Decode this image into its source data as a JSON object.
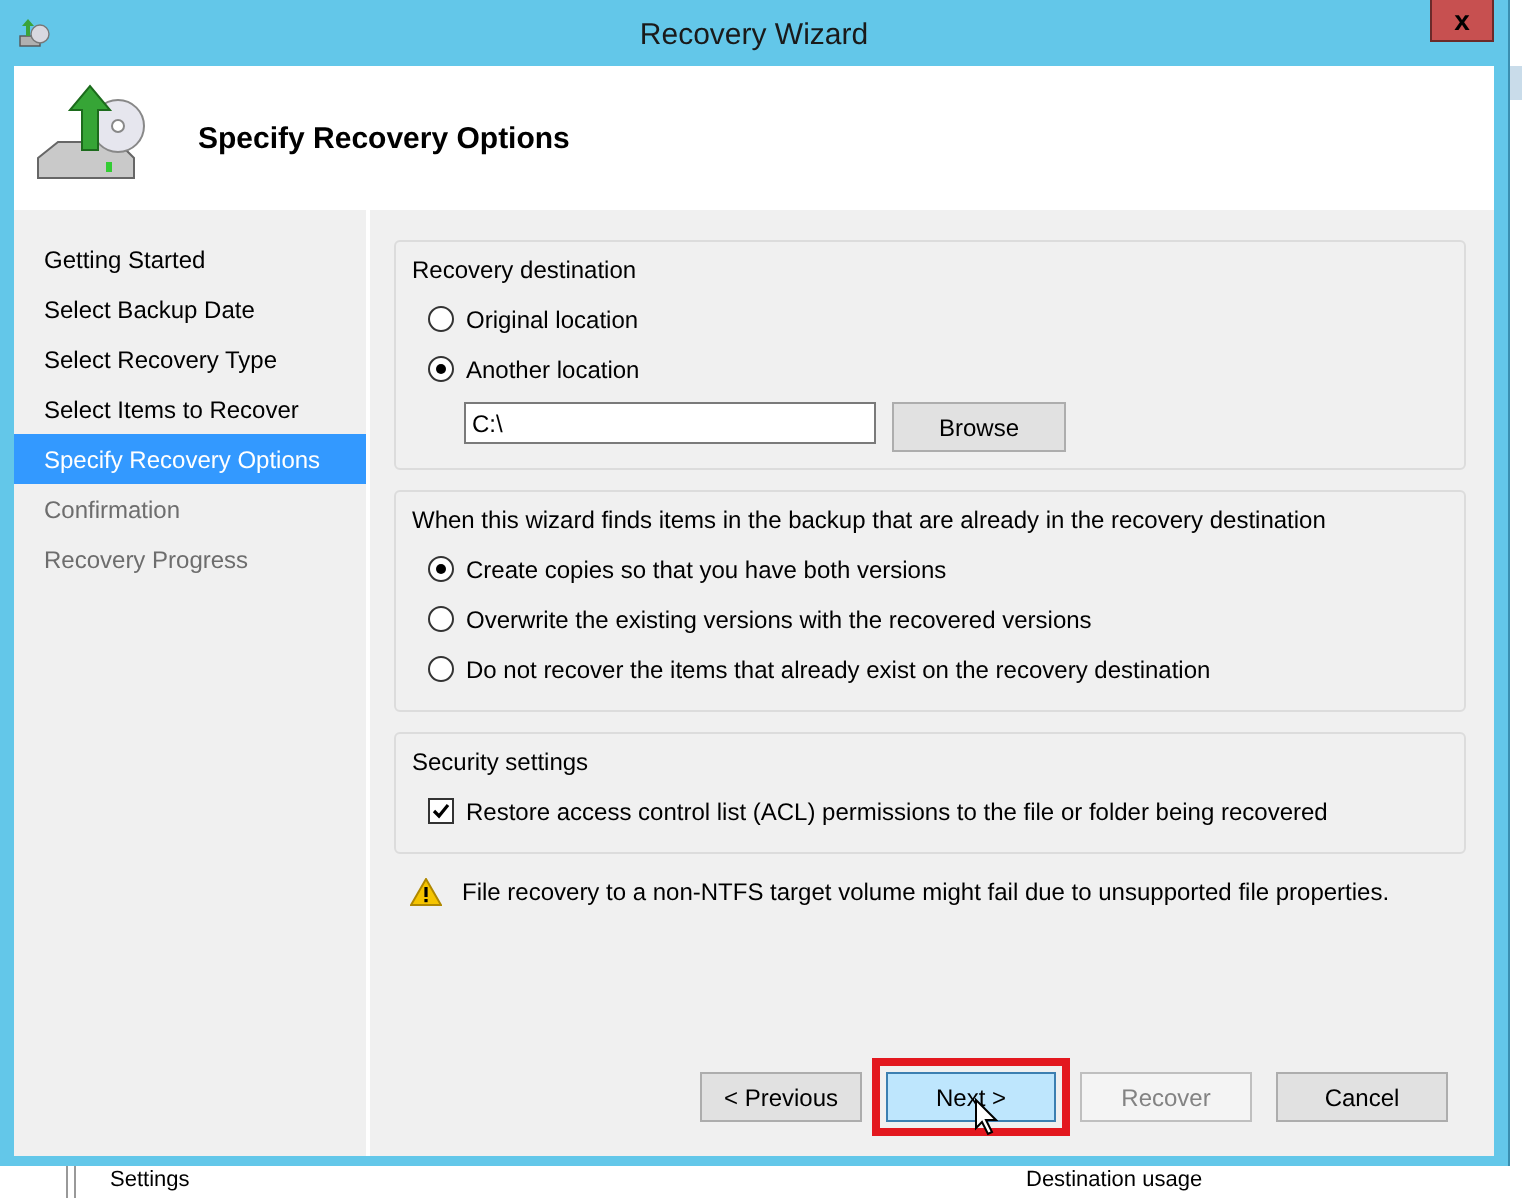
{
  "background_window": {
    "group_labels": [
      "Settings",
      "Destination usage"
    ]
  },
  "window": {
    "title": "Recovery Wizard",
    "close": "x"
  },
  "header": {
    "title": "Specify Recovery Options"
  },
  "sidebar": {
    "items": [
      {
        "label": "Getting Started",
        "selected": false,
        "disabled": false
      },
      {
        "label": "Select Backup Date",
        "selected": false,
        "disabled": false
      },
      {
        "label": "Select Recovery Type",
        "selected": false,
        "disabled": false
      },
      {
        "label": "Select Items to Recover",
        "selected": false,
        "disabled": false
      },
      {
        "label": "Specify Recovery Options",
        "selected": true,
        "disabled": false
      },
      {
        "label": "Confirmation",
        "selected": false,
        "disabled": true
      },
      {
        "label": "Recovery Progress",
        "selected": false,
        "disabled": true
      }
    ]
  },
  "groups": [
    {
      "title": "Recovery destination",
      "options": [
        {
          "kind": "radio",
          "label": "Original location",
          "selected": false
        },
        {
          "kind": "radio",
          "label": "Another location",
          "selected": true
        }
      ],
      "path": {
        "value": "C:\\",
        "button": "Browse"
      }
    },
    {
      "title": "When this wizard finds items in the backup that are already in the recovery destination",
      "options": [
        {
          "kind": "radio",
          "label": "Create copies so that you have both versions",
          "selected": true
        },
        {
          "kind": "radio",
          "label": "Overwrite the existing versions with the recovered versions",
          "selected": false
        },
        {
          "kind": "radio",
          "label": "Do not recover the items that already exist on the recovery destination",
          "selected": false
        }
      ]
    },
    {
      "title": "Security settings",
      "options": [
        {
          "kind": "checkbox",
          "label": "Restore access control list (ACL) permissions to the file or folder being recovered",
          "checked": true
        }
      ]
    }
  ],
  "warning": "File recovery to a non-NTFS target volume might fail due to unsupported file properties.",
  "buttons": [
    {
      "label": "< Previous",
      "default": false,
      "disabled": false,
      "annotated": false
    },
    {
      "label": "Next >",
      "default": true,
      "disabled": false,
      "annotated": true
    },
    {
      "label": "Recover",
      "default": false,
      "disabled": true,
      "annotated": false
    },
    {
      "label": "Cancel",
      "default": false,
      "disabled": false,
      "annotated": false
    }
  ]
}
